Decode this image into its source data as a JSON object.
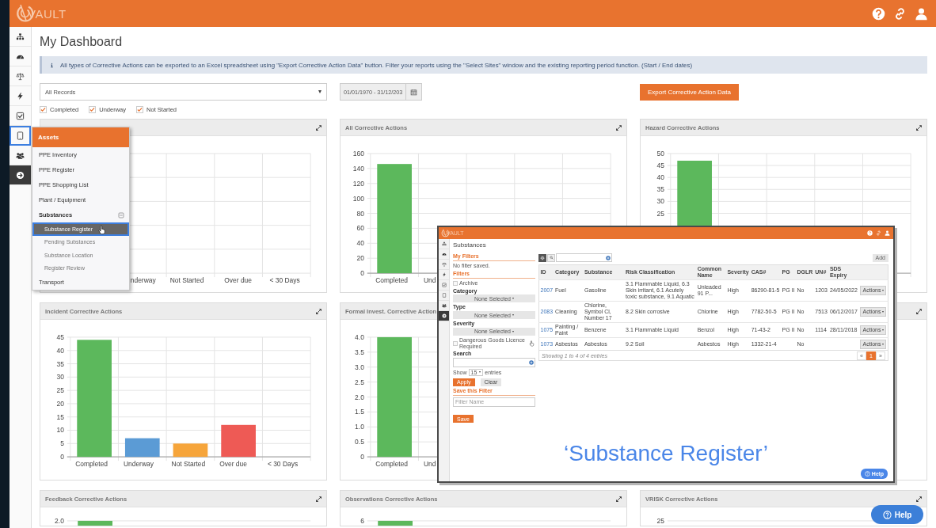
{
  "topbar": {
    "logo": "VAULT"
  },
  "sidebar": {
    "items": [
      {
        "kind": "hierarchy",
        "selected": false
      },
      {
        "kind": "gauge",
        "selected": false
      },
      {
        "kind": "scales",
        "selected": false
      },
      {
        "kind": "lightning",
        "selected": false
      },
      {
        "kind": "checkbox",
        "selected": false
      },
      {
        "kind": "tablet",
        "selected": true
      },
      {
        "kind": "people",
        "selected": false
      },
      {
        "kind": "arrow",
        "selected": false
      }
    ]
  },
  "page": {
    "title": "My Dashboard",
    "info": "All types of Corrective Actions can be exported to an Excel spreadsheet using \"Export Corrective Action Data\" button. Filter your reports using the \"Select Sites\" window and the existing reporting period function. (Start / End dates)",
    "records_select": {
      "value": "All Records"
    },
    "date_range": {
      "value": "01/01/1970 - 31/12/203"
    },
    "export_button": "Export Corrective Action Data",
    "status_checks": [
      {
        "label": "Completed",
        "checked": true
      },
      {
        "label": "Underway",
        "checked": true
      },
      {
        "label": "Not Started",
        "checked": true
      }
    ]
  },
  "panels": [
    {
      "expanded": false,
      "x_labels": [
        "nderway",
        "Not Started",
        "Over due",
        "< 30 Days"
      ]
    },
    {
      "title": "All Corrective Actions",
      "expanded": false,
      "chart_data": {
        "type": "bar",
        "categories": [
          "Completed",
          "Und"
        ],
        "series": [
          {
            "color": "#5cb85c",
            "values": [
              146,
              null
            ]
          }
        ],
        "grid": true,
        "ylim": [
          0,
          160
        ],
        "yticks": [
          0,
          20,
          40,
          60,
          80,
          100,
          120,
          140,
          160
        ]
      }
    },
    {
      "title": "Hazard Corrective Actions",
      "expanded": false,
      "chart_data": {
        "type": "bar",
        "series": [
          {
            "color": "#5cb85c",
            "values": [
              47
            ]
          }
        ],
        "grid": true,
        "ylim": [
          0,
          50
        ],
        "yticks": [
          25,
          30,
          35,
          40,
          45,
          50
        ]
      }
    },
    {
      "title": "Incident Corrective Actions",
      "expanded": false,
      "chart_data": {
        "type": "bar",
        "categories": [
          "Completed",
          "Underway",
          "Not Started",
          "Over due",
          "< 30 Days"
        ],
        "series": [
          {
            "color": "#5cb85c",
            "values": [
              44,
              null,
              null,
              null,
              null
            ]
          },
          {
            "color": "#5b9bd5",
            "values": [
              null,
              7,
              null,
              null,
              null
            ]
          },
          {
            "color": "#f6a53b",
            "values": [
              null,
              null,
              5,
              null,
              null
            ]
          },
          {
            "color": "#ee5a55",
            "values": [
              null,
              null,
              null,
              12,
              null
            ]
          }
        ],
        "stacked": true,
        "grid": true,
        "ylim": [
          0,
          45
        ],
        "yticks": [
          0,
          5,
          10,
          15,
          20,
          25,
          30,
          35,
          40,
          45
        ]
      }
    },
    {
      "title": "Formal Invest. Corrective Action",
      "chart_data": {
        "type": "bar",
        "categories": [
          "Completed",
          "Und"
        ],
        "series": [
          {
            "color": "#5cb85c",
            "values": [
              4,
              null
            ]
          }
        ],
        "grid": true,
        "ylim": [
          0,
          4
        ],
        "yticks": [
          {
            "value": 0,
            "label": "0"
          },
          {
            "value": 0.5,
            "label": "0.5"
          },
          {
            "value": 1,
            "label": "1.0"
          },
          {
            "value": 1.5,
            "label": "1.5"
          },
          {
            "value": 2,
            "label": "2.0"
          },
          {
            "value": 2.5,
            "label": "2.5"
          },
          {
            "value": 3,
            "label": "3.0"
          },
          {
            "value": 3.5,
            "label": "3.5"
          },
          {
            "value": 4,
            "label": "4.0"
          }
        ]
      }
    },
    {
      "expanded": false
    },
    {
      "title": "Feedback Corrective Actions",
      "expanded": false,
      "tick_label": "2.0",
      "bar_visible": true
    },
    {
      "title": "Observations Corrective Actions",
      "expanded": false,
      "tick_label": "6",
      "bar_visible": true
    },
    {
      "title": "VRISK Corrective Actions",
      "expanded": false,
      "tick_label": "25",
      "bar_visible": false
    }
  ],
  "assets_menu": {
    "title": "Assets",
    "items": [
      {
        "kind": "link",
        "label": "PPE Inventory"
      },
      {
        "kind": "link",
        "label": "PPE Register"
      },
      {
        "kind": "link",
        "label": "PPE Shopping List"
      },
      {
        "kind": "link",
        "label": "Plant / Equipment"
      },
      {
        "kind": "group",
        "label": "Substances",
        "expanded": true,
        "children": [
          {
            "label": "Substance Register",
            "selected": true
          },
          {
            "label": "Pending Substances",
            "selected": false
          },
          {
            "label": "Substance Location",
            "selected": false
          },
          {
            "label": "Register Review",
            "selected": false
          }
        ]
      },
      {
        "kind": "link",
        "label": "Transport"
      }
    ]
  },
  "substances_window": {
    "logo": "VAULT",
    "sidebar": {
      "items": [
        {
          "kind": "hierarchy",
          "selected": false
        },
        {
          "kind": "gauge",
          "selected": false
        },
        {
          "kind": "scales",
          "selected": false
        },
        {
          "kind": "lightning",
          "selected": false
        },
        {
          "kind": "checkbox",
          "selected": false
        },
        {
          "kind": "tablet",
          "selected": false
        },
        {
          "kind": "people",
          "selected": false
        },
        {
          "kind": "arrow",
          "selected": false
        }
      ]
    },
    "title": "Substances",
    "filters": {
      "my_filters": "My Filters",
      "no_filter": "No filter saved.",
      "filters": "Filters",
      "archive": {
        "label": "Archive",
        "checked": false
      },
      "category": {
        "label": "Category",
        "value": "None Selected"
      },
      "type": {
        "label": "Type",
        "value": "None Selected"
      },
      "severity": {
        "label": "Severity",
        "value": "None Selected"
      },
      "dg_licence": {
        "label": "Dangerous Goods Licence Required",
        "checked": false
      },
      "search": {
        "label": "Search"
      },
      "show": {
        "before": "Show",
        "value": "15",
        "after": "entries"
      },
      "apply": "Apply",
      "clear": "Clear",
      "save_heading": "Save this Filter",
      "filter_name": {
        "placeholder": "Filter Name"
      },
      "save": "Save"
    },
    "add_button": "Add",
    "table": {
      "columns": [
        "ID",
        "Category",
        "Substance",
        "Risk Classification",
        "Common Name",
        "Severity",
        "CAS#",
        "PG",
        "DGLR",
        "UN#",
        "SDS Expiry"
      ],
      "rows": [
        {
          "cells": [
            "2007",
            "Fuel",
            "Gasoline",
            "3.1 Flammable Liquid, 6.3 Skin irritant, 6.1 Acutely toxic substance, 9.1 Aquatic",
            "Unleaded 91 P...",
            "High",
            "86290-81-5",
            "PG II",
            "No",
            "1203",
            "24/05/2022"
          ],
          "action": "Actions"
        },
        {
          "cells": [
            "2083",
            "Cleaning",
            "Chlorine, Symbol Cl, Number 17",
            "8.2 Skin corrosive",
            "Chlorine",
            "High",
            "7782-50-5",
            "PG II",
            "No",
            "7513",
            "06/12/2017"
          ],
          "action": "Actions"
        },
        {
          "cells": [
            "1075",
            "Painting / Paint",
            "Benzene",
            "3.1 Flammable Liquid",
            "Benzol",
            "High",
            "71-43-2",
            "PG II",
            "No",
            "1114",
            "28/11/2018"
          ],
          "action": "Actions"
        },
        {
          "cells": [
            "1073",
            "Asbestos",
            "Asbestos",
            "9.2 Soil",
            "Asbestos",
            "High",
            "1332-21-4",
            null,
            "No",
            null,
            null
          ],
          "action": "Actions"
        }
      ],
      "footer": "Showing 1 to 4 of 4 entries",
      "pagination": [
        {
          "label": "«",
          "selected": false
        },
        {
          "label": "1",
          "selected": true
        },
        {
          "label": "»",
          "selected": false
        }
      ]
    },
    "caption": "‘Substance Register’",
    "help_button": "Help"
  },
  "help_button": "Help"
}
